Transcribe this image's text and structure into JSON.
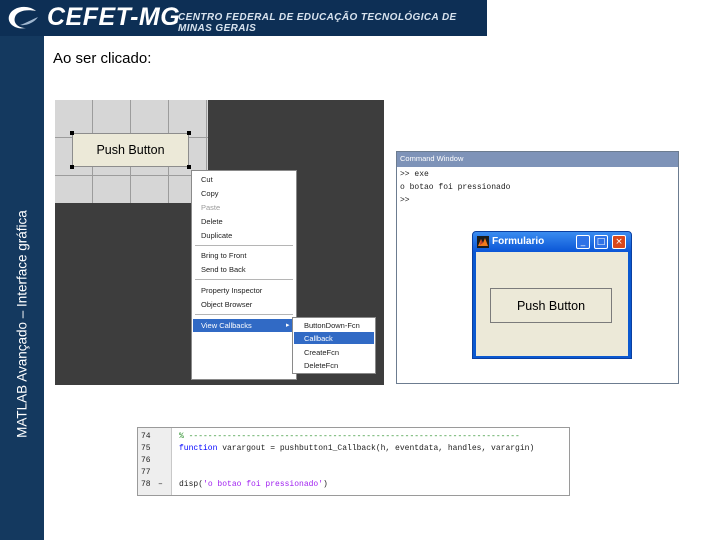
{
  "banner": {
    "brand": "CEFET-MG",
    "subtitle": "CENTRO FEDERAL DE EDUCAÇÃO TECNOLÓGICA DE MINAS GERAIS",
    "logo_icon": "cefet-swirl-logo-icon"
  },
  "sidebar": {
    "text": "MATLAB Avançado – Interface gráfica"
  },
  "caption": "Ao ser clicado:",
  "guide": {
    "push_button_label": "Push Button",
    "context_menu": [
      {
        "label": "Cut",
        "disabled": false
      },
      {
        "label": "Copy",
        "disabled": false
      },
      {
        "label": "Paste",
        "disabled": true
      },
      {
        "label": "Delete",
        "disabled": false
      },
      {
        "label": "Duplicate",
        "disabled": false
      },
      {
        "label": "Bring to Front",
        "disabled": false
      },
      {
        "label": "Send to Back",
        "disabled": false
      },
      {
        "label": "Property Inspector",
        "disabled": false
      },
      {
        "label": "Object Browser",
        "disabled": false
      },
      {
        "label": "View Callbacks",
        "disabled": false
      }
    ],
    "submenu": [
      "ButtonDown-Fcn",
      "Callback",
      "CreateFcn",
      "DeleteFcn"
    ],
    "colors": {
      "highlight": "#316ac5"
    }
  },
  "command_window": {
    "title": "Command Window",
    "lines": [
      ">> exe",
      "o botao foi pressionado",
      ">>"
    ]
  },
  "figure_window": {
    "title": "Formulario",
    "minimize": "_",
    "maximize": "□",
    "close": "×",
    "push_button_label": "Push Button"
  },
  "editor": {
    "lines": [
      {
        "num": "74",
        "dash": "",
        "text": "% ---------------------------------------------------------------------",
        "kind": "comment"
      },
      {
        "num": "75",
        "dash": "",
        "keyword": "function",
        "text": " varargout = pushbutton1_Callback(h, eventdata, handles, varargin)",
        "kind": "function"
      },
      {
        "num": "76",
        "dash": "",
        "text": "",
        "kind": "plain"
      },
      {
        "num": "77",
        "dash": "",
        "text": "",
        "kind": "plain"
      },
      {
        "num": "78",
        "dash": "–",
        "text_before": "disp(",
        "string": "'o botao foi pressionado'",
        "text_after": ")",
        "kind": "disp"
      }
    ]
  }
}
